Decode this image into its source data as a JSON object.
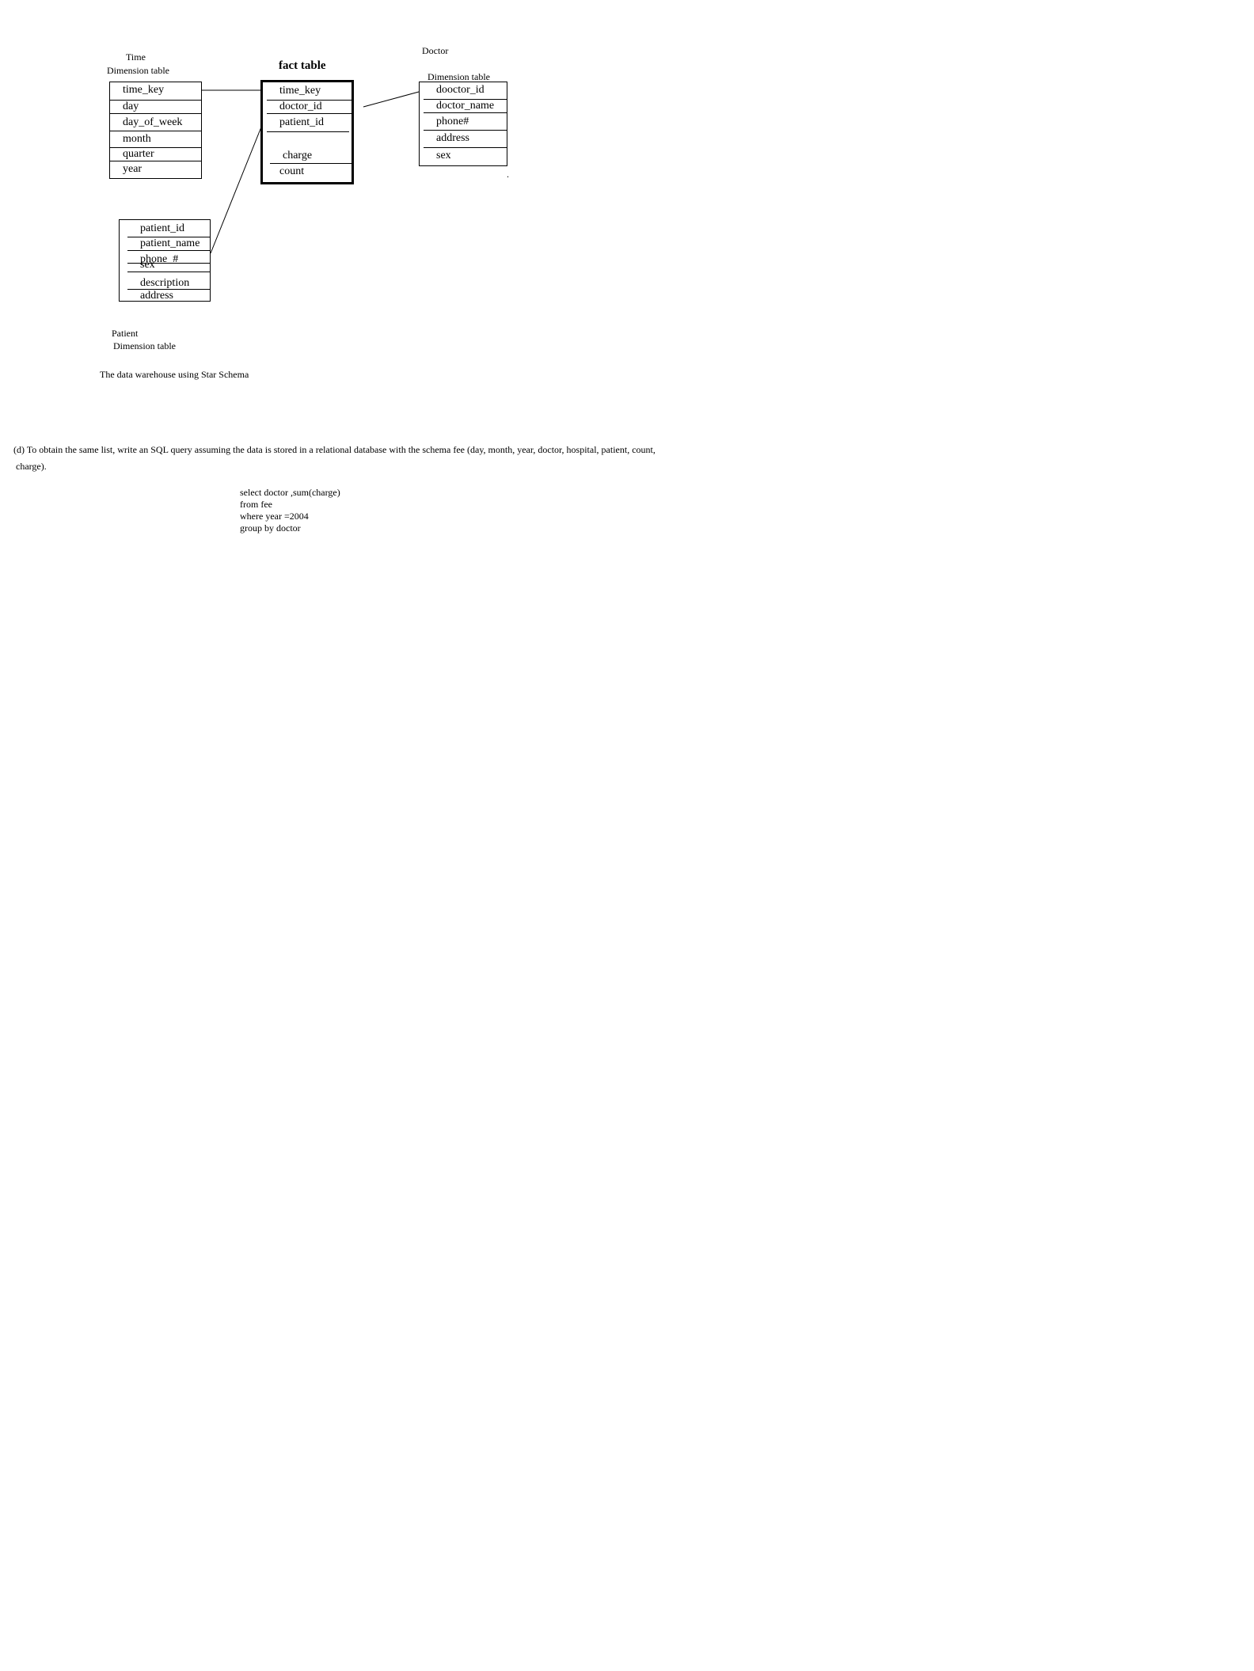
{
  "diagram": {
    "time_dim": {
      "title_line1": "Time",
      "title_line2": "Dimension table",
      "fields": [
        "time_key",
        "day",
        "day_of_week",
        "month",
        "quarter",
        "year"
      ]
    },
    "fact": {
      "title": "fact table",
      "fields": [
        "time_key",
        "doctor_id",
        "patient_id",
        "charge",
        "count"
      ]
    },
    "doctor_dim": {
      "title_line1": "Doctor",
      "title_line2": "Dimension table",
      "fields": [
        "dooctor_id",
        "doctor_name",
        "phone#",
        "address",
        "sex"
      ]
    },
    "patient_dim": {
      "title_line1": "Patient",
      "title_line2": "Dimension table",
      "fields": [
        "patient_id",
        "patient_name",
        "phone_#",
        "sex",
        "description",
        "address"
      ]
    },
    "caption": "The   data warehouse using Star Schema",
    "stray_mark": "."
  },
  "question": {
    "line1": "(d) To obtain the same list, write an SQL query assuming the data is stored in a relational database with the schema fee (day, month, year, doctor, hospital, patient, count,",
    "line2": "charge)."
  },
  "sql": {
    "lines": [
      "select doctor  ,sum(charge)",
      "from fee",
      "where year =2004",
      "group by doctor"
    ]
  }
}
